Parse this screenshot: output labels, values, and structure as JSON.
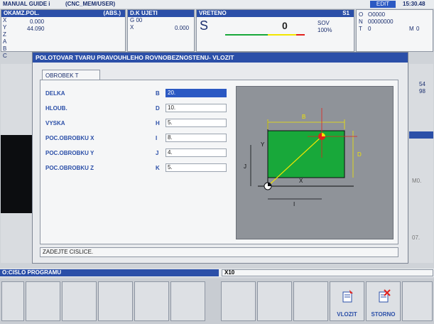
{
  "top_bar": {
    "mode": "MANUAL GUIDE i",
    "path": "(CNC_MEM/USER)",
    "state": "EDIT",
    "clock": "15:30.48"
  },
  "position": {
    "header": "OKAMZ.POL.",
    "mode": "(ABS.)",
    "axes": [
      "X",
      "Y",
      "Z",
      "A",
      "B",
      "C"
    ],
    "x_value": "0.000",
    "y_value": "44.090"
  },
  "dk_panel": {
    "header": "D.K UJETI",
    "gcode": "G 00",
    "axis": "X",
    "value": "0.000"
  },
  "spindle": {
    "header": "VRETENO",
    "id": "S1",
    "s_label": "S",
    "s_value": "0",
    "sov_label": "SOV",
    "sov_value": "100%"
  },
  "program_info": {
    "o_label": "O",
    "o_value": "O0000",
    "n_label": "N",
    "n_value": "00000000",
    "t_label": "T",
    "t_value": "0",
    "m_label": "M",
    "m_value": "0"
  },
  "right_side": {
    "val1": "54",
    "val2": "98",
    "m0": "M0.",
    "o7": "07."
  },
  "dialog": {
    "title": "POLOTOVAR TVARU PRAVOUHLEHO ROVNOBEZNOSTENU- VLOZIT",
    "tab": "OBROBEK T",
    "message": "ZADEJTE CISLICE.",
    "fields": [
      {
        "label": "DELKA",
        "code": "B",
        "value": "20."
      },
      {
        "label": "HLOUB.",
        "code": "D",
        "value": "10."
      },
      {
        "label": "VYSKA",
        "code": "H",
        "value": "5."
      },
      {
        "label": "POC.OBROBKU X",
        "code": "I",
        "value": "8."
      },
      {
        "label": "POC.OBROBKU Y",
        "code": "J",
        "value": "4."
      },
      {
        "label": "POC.OBROBKU Z",
        "code": "K",
        "value": "5."
      }
    ],
    "diagram": {
      "b": "B",
      "d": "D",
      "j": "J",
      "i": "I",
      "x": "X",
      "y": "Y"
    }
  },
  "status_bar": {
    "left": "O:CISLO PROGRAMU",
    "right": "X10"
  },
  "softkeys": {
    "insert": "VLOZIT",
    "cancel": "STORNO",
    "insert_icon": "insert-document-icon",
    "cancel_icon": "cancel-document-icon"
  },
  "colors": {
    "header_blue": "#2b4fa8",
    "active_field": "#2b59c3",
    "diagram_green": "#18a83a",
    "diagram_red": "#e2211c",
    "diagram_yellow": "#f2e600"
  }
}
